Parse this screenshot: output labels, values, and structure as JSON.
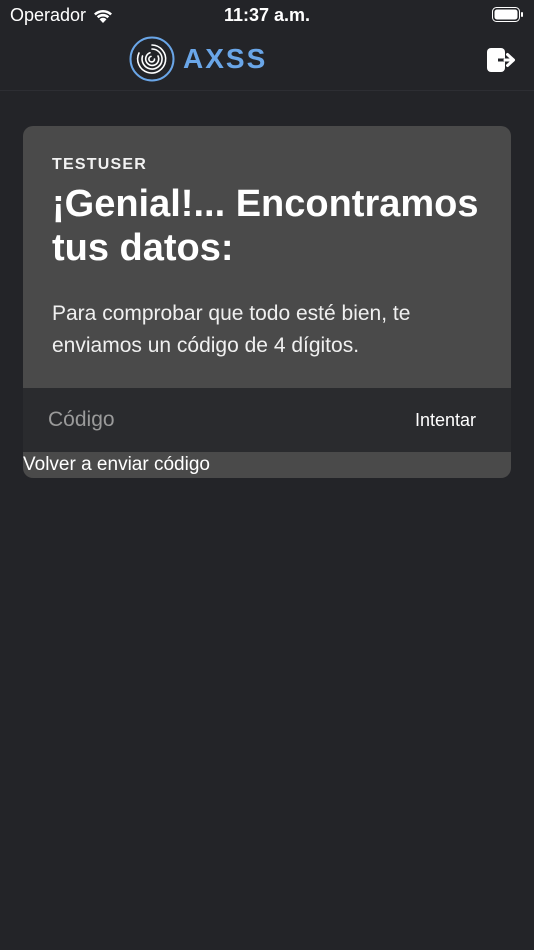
{
  "status_bar": {
    "carrier": "Operador",
    "time": "11:37 a.m.",
    "wifi_icon": "wifi-icon",
    "battery_icon": "battery-icon"
  },
  "nav": {
    "logo_text": "AXSS",
    "logo_icon": "fingerprint-icon",
    "logout_icon": "logout-icon"
  },
  "card": {
    "username": "TESTUSER",
    "headline": "¡Genial!... Encontramos tus datos:",
    "description": "Para comprobar que todo esté bien, te enviamos un código de 4 dígitos.",
    "code_input": {
      "value": "",
      "placeholder": "Código"
    },
    "try_label": "Intentar",
    "resend_label": "Volver a enviar código"
  },
  "colors": {
    "background": "#232428",
    "card": "#4a4a4a",
    "input_row": "#2a2b2e",
    "logo_accent": "#6aa6e8"
  }
}
